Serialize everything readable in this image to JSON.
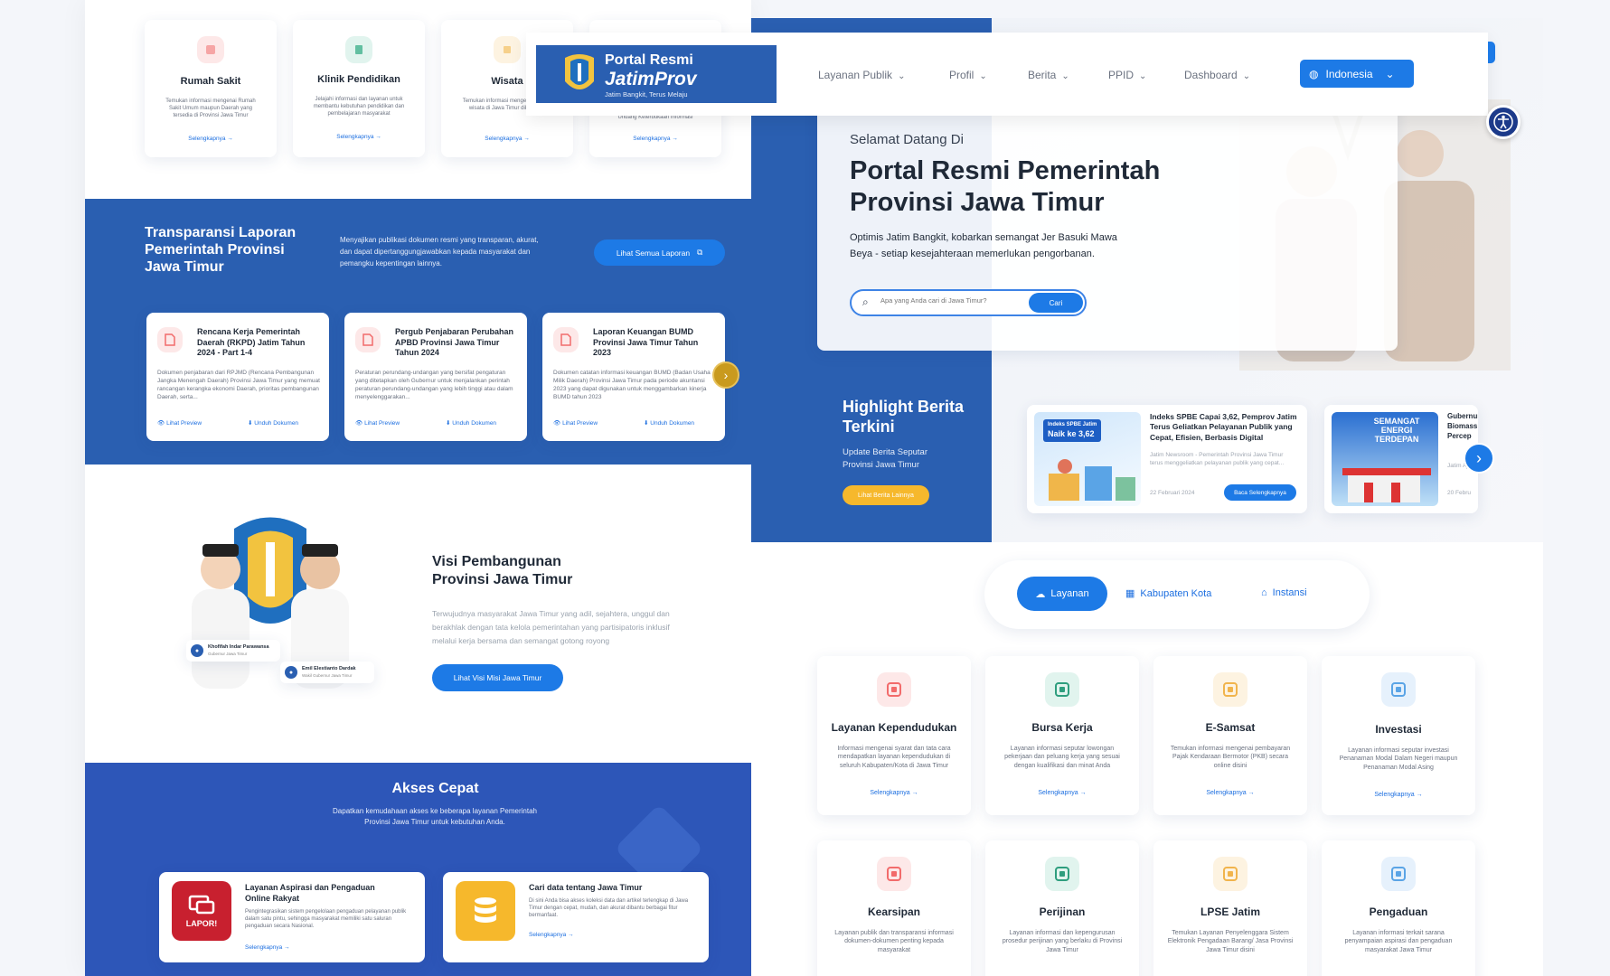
{
  "header": {
    "logo_title": "Portal Resmi",
    "logo_brand": "JatimProv",
    "logo_tagline": "Jatim Bangkit, Terus Melaju",
    "nav": [
      "Layanan Publik",
      "Profil",
      "Berita",
      "PPID",
      "Dashboard"
    ],
    "language": "Indonesia"
  },
  "top_services": [
    {
      "title": "Rumah Sakit",
      "desc": "Temukan informasi mengenai Rumah Sakit Umum maupun Daerah yang tersedia di Provinsi Jawa Timur",
      "link": "Selengkapnya"
    },
    {
      "title": "Klinik Pendidikan",
      "desc": "Jelajahi informasi dan layanan untuk membantu kebutuhan pendidikan dan pembelajaran masyarakat",
      "link": "Selengkapnya"
    },
    {
      "title": "Wisata",
      "desc": "Temukan informasi mengenai tempat wisata di Jawa Timur dikunjungi",
      "link": "Selengkapnya"
    },
    {
      "title": "",
      "desc": "Undang Keterbukaan Informasi",
      "link": "Selengkapnya"
    }
  ],
  "transparansi": {
    "title": "Transparansi Laporan Pemerintah Provinsi Jawa Timur",
    "desc": "Menyajikan publikasi dokumen resmi yang transparan, akurat, dan dapat dipertanggungjawabkan kepada masyarakat dan pemangku kepentingan lainnya.",
    "button": "Lihat Semua Laporan",
    "docs": [
      {
        "title": "Rencana Kerja Pemerintah Daerah (RKPD) Jatim Tahun 2024 - Part 1-4",
        "desc": "Dokumen penjabaran dari RPJMD (Rencana Pembangunan Jangka Menengah Daerah) Provinsi Jawa Timur yang memuat rancangan kerangka ekonomi Daerah, prioritas pembangunan Daerah, serta...",
        "preview": "Lihat Preview",
        "download": "Unduh Dokumen"
      },
      {
        "title": "Pergub Penjabaran Perubahan APBD Provinsi Jawa Timur Tahun 2024",
        "desc": "Peraturan perundang-undangan yang bersifat pengaturan yang ditetapkan oleh Gubernur untuk menjalankan perintah peraturan perundang-undangan yang lebih tinggi atau dalam menyelenggarakan...",
        "preview": "Lihat Preview",
        "download": "Unduh Dokumen"
      },
      {
        "title": "Laporan Keuangan BUMD Provinsi Jawa Timur Tahun 2023",
        "desc": "Dokumen catatan informasi keuangan BUMD (Badan Usaha Milik Daerah) Provinsi Jawa Timur pada periode akuntansi 2023 yang dapat digunakan untuk menggambarkan kinerja BUMD tahun 2023",
        "preview": "Lihat Preview",
        "download": "Unduh Dokumen"
      }
    ]
  },
  "visi": {
    "title": "Visi Pembangunan Provinsi Jawa Timur",
    "desc": "Terwujudnya masyarakat Jawa Timur yang adil, sejahtera, unggul dan berakhlak dengan tata kelola pemerintahan yang partisipatoris inklusif melalui kerja bersama dan semangat gotong royong",
    "button": "Lihat Visi Misi Jawa Timur",
    "leader1_name": "Khofifah Indar Parawansa",
    "leader1_role": "Gubernur Jawa Timur",
    "leader2_name": "Emil Elestianto Dardak",
    "leader2_role": "Wakil Gubernur Jawa Timur"
  },
  "akses": {
    "title": "Akses Cepat",
    "desc": "Dapatkan kemudahaan akses ke beberapa layanan Pemerintah Provinsi Jawa Timur untuk kebutuhan Anda.",
    "items": [
      {
        "title": "Layanan Aspirasi dan Pengaduan Online Rakyat",
        "desc": "Pengintegrasikan sistem pengelolaan pengaduan pelayanan publik dalam satu pintu, sehingga masyarakat memiliki satu saluran pengaduan secara Nasional.",
        "link": "Selengkapnya",
        "badge": "LAPOR!"
      },
      {
        "title": "Cari data tentang Jawa Timur",
        "desc": "Di sini Anda bisa akses koleksi data dan artikel terlengkap di Jawa Timur dengan cepat, mudah, dan akurat dibantu berbagai fitur bermanfaat.",
        "link": "Selengkapnya"
      }
    ]
  },
  "hero": {
    "greeting": "Selamat Datang Di",
    "title": "Portal Resmi Pemerintah Provinsi Jawa Timur",
    "desc": "Optimis Jatim Bangkit, kobarkan semangat Jer Basuki Mawa Beya - setiap kesejahteraan memerlukan pengorbanan.",
    "search_placeholder": "Apa yang Anda cari di Jawa Timur?",
    "search_button": "Cari"
  },
  "highlight": {
    "title": "Highlight Berita Terkini",
    "subtitle": "Update Berita Seputar Provinsi Jawa Timur",
    "button": "Lihat Berita Lainnya",
    "news": [
      {
        "title": "Indeks SPBE Capai 3,62, Pemprov Jatim Terus Geliatkan Pelayanan Publik yang Cepat, Efisien, Berbasis Digital",
        "excerpt": "Jatim Newsroom - Pemerintah Provinsi Jawa Timur terus menggeliatkan pelayanan publik yang cepat...",
        "date": "22 Februari 2024",
        "button": "Baca Selengkapnya",
        "img_text1": "Indeks SPBE Jatim",
        "img_text2": "Naik ke 3,62"
      },
      {
        "title": "Gubernur Biomass Percep",
        "excerpt": "Jatim Ajron",
        "date": "20 Febru",
        "img_text1": "SEMANGAT ENERGI TERDEPAN"
      }
    ]
  },
  "tabs": [
    "Layanan",
    "Kabupaten Kota",
    "Instansi"
  ],
  "layanan": [
    {
      "title": "Layanan Kependudukan",
      "desc": "Informasi mengenai syarat dan tata cara mendapatkan layanan kependudukan di seluruh Kabupaten/Kota di Jawa Timur",
      "link": "Selengkapnya",
      "color": "#f26b6b",
      "bg": "#fde8e8"
    },
    {
      "title": "Bursa Kerja",
      "desc": "Layanan informasi seputar lowongan pekerjaan dan peluang kerja yang sesuai dengan kualifikasi dan minat Anda",
      "link": "Selengkapnya",
      "color": "#2e9e7e",
      "bg": "#e1f4ee"
    },
    {
      "title": "E-Samsat",
      "desc": "Temukan informasi mengenai pembayaran Pajak Kendaraan Bermotor (PKB) secara online disini",
      "link": "Selengkapnya",
      "color": "#f1b44c",
      "bg": "#fdf3e1"
    },
    {
      "title": "Investasi",
      "desc": "Layanan informasi seputar investasi Penanaman Modal Dalam Negeri maupun Penanaman Modal Asing",
      "link": "Selengkapnya",
      "color": "#5aa4e6",
      "bg": "#e6f1fc"
    },
    {
      "title": "Kearsipan",
      "desc": "Layanan publik dan transparansi informasi dokumen-dokumen penting kepada masyarakat",
      "color": "#f26b6b",
      "bg": "#fde8e8"
    },
    {
      "title": "Perijinan",
      "desc": "Layanan informasi dan kepengurusan prosedur perijinan yang berlaku di Provinsi Jawa Timur",
      "color": "#2e9e7e",
      "bg": "#e1f4ee"
    },
    {
      "title": "LPSE Jatim",
      "desc": "Temukan Layanan Penyelenggara Sistem Elektronik Pengadaan Barang/ Jasa Provinsi Jawa Timur disini",
      "color": "#f1b44c",
      "bg": "#fdf3e1"
    },
    {
      "title": "Pengaduan",
      "desc": "Layanan informasi terkait sarana penyampaian aspirasi dan pengaduan masyarakat Jawa Timur",
      "color": "#5aa4e6",
      "bg": "#e6f1fc"
    }
  ],
  "colors": {
    "primary": "#2a5fb1",
    "accent": "#1d7ae6",
    "yellow": "#f6b82c",
    "red": "#c8202f"
  }
}
